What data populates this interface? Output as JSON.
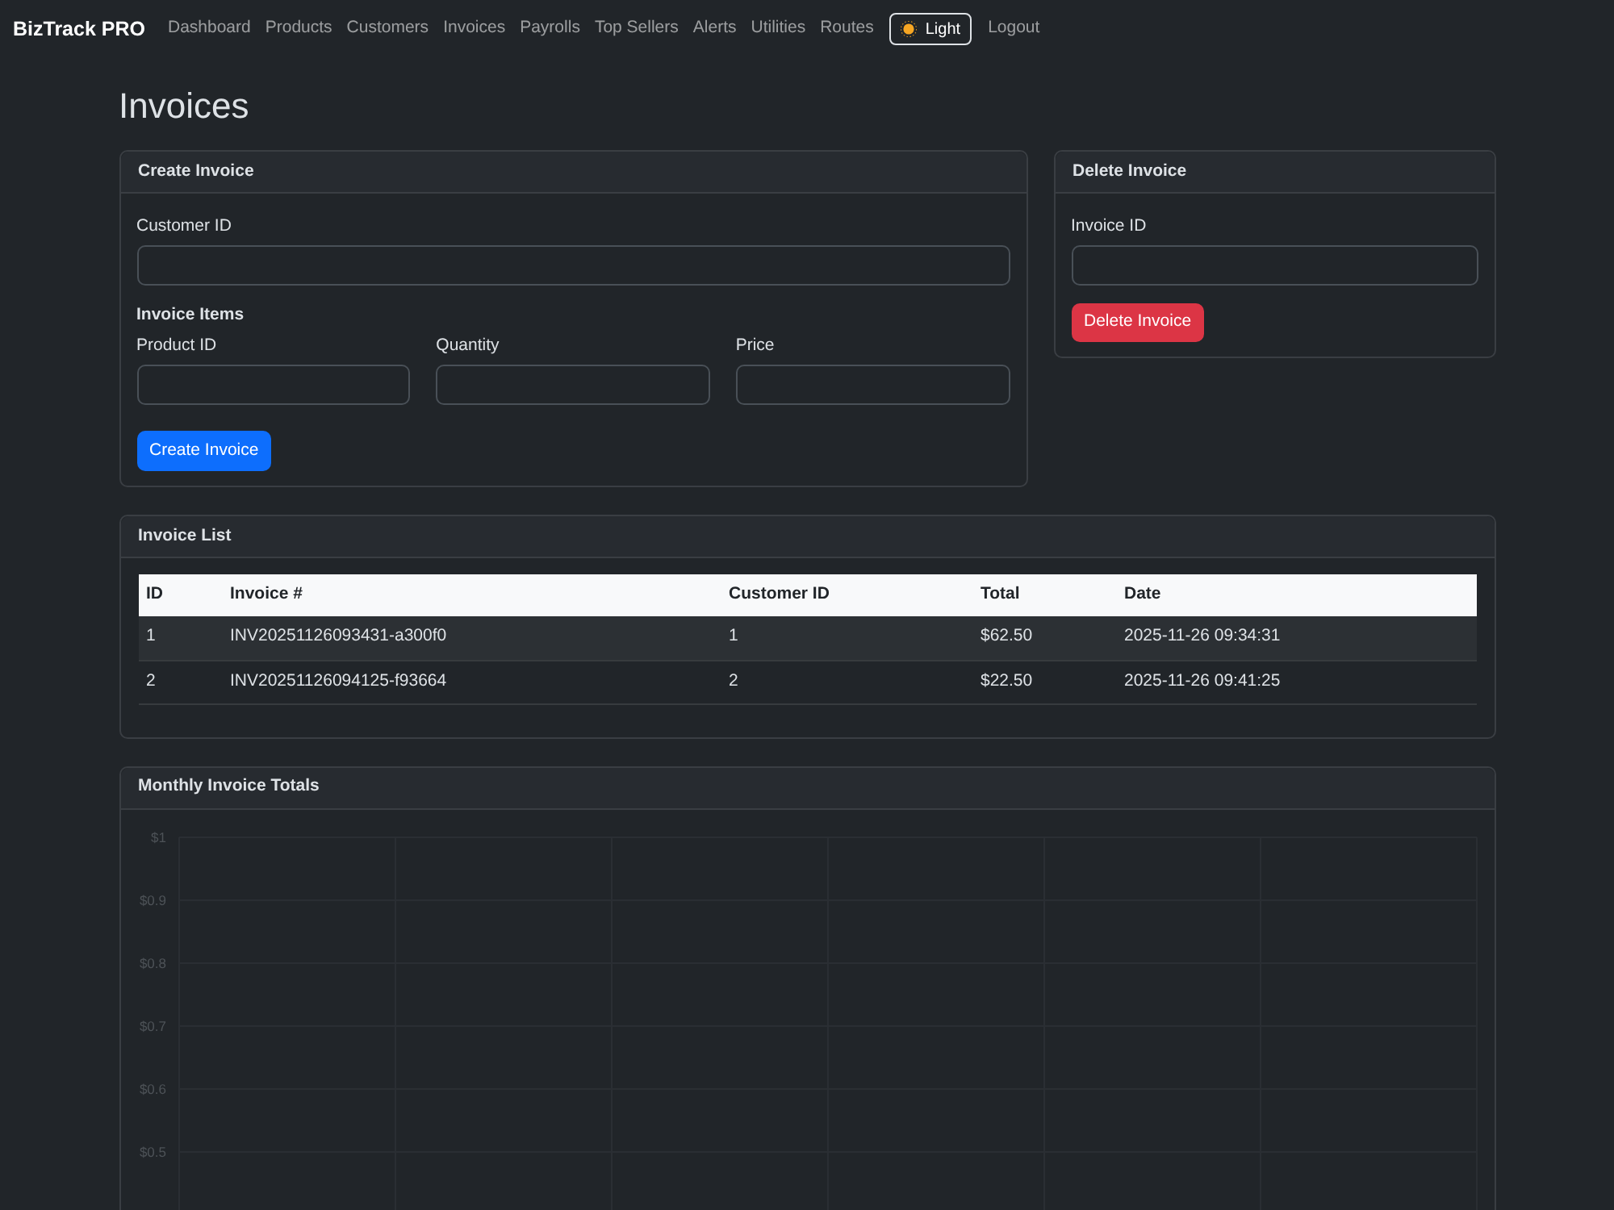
{
  "navbar": {
    "brand": "BizTrack PRO",
    "links": [
      "Dashboard",
      "Products",
      "Customers",
      "Invoices",
      "Payrolls",
      "Top Sellers",
      "Alerts",
      "Utilities",
      "Routes"
    ],
    "theme_button": "Light",
    "logout": "Logout"
  },
  "page_title": "Invoices",
  "create_invoice": {
    "title": "Create Invoice",
    "customer_field": {
      "label": "Customer ID"
    },
    "items_heading": "Invoice Items",
    "item_fields": [
      {
        "label": "Product ID"
      },
      {
        "label": "Quantity"
      },
      {
        "label": "Price"
      }
    ],
    "button": "Create Invoice"
  },
  "delete_invoice": {
    "title": "Delete Invoice",
    "field": {
      "label": "Invoice ID"
    },
    "button": "Delete Invoice"
  },
  "invoice_list": {
    "title": "Invoice List",
    "columns": [
      "ID",
      "Invoice #",
      "Customer ID",
      "Total",
      "Date"
    ],
    "rows": [
      [
        "1",
        "INV20251126093431-a300f0",
        "1",
        "$62.50",
        "2025-11-26 09:34:31"
      ],
      [
        "2",
        "INV20251126094125-f93664",
        "2",
        "$22.50",
        "2025-11-26 09:41:25"
      ]
    ]
  },
  "monthly_totals": {
    "title": "Monthly Invoice Totals",
    "chart_data": {
      "type": "bar",
      "categories": [
        null,
        null,
        null,
        null,
        null,
        null
      ],
      "ylim": [
        0.4,
        1
      ],
      "yticks": [
        {
          "value": 1,
          "label": "$1"
        },
        {
          "value": 0.9,
          "label": "$0.9"
        },
        {
          "value": 0.8,
          "label": "$0.8"
        },
        {
          "value": 0.7,
          "label": "$0.7"
        },
        {
          "value": 0.6,
          "label": "$0.6"
        },
        {
          "value": 0.5,
          "label": "$0.5"
        }
      ],
      "grid": true
    }
  }
}
